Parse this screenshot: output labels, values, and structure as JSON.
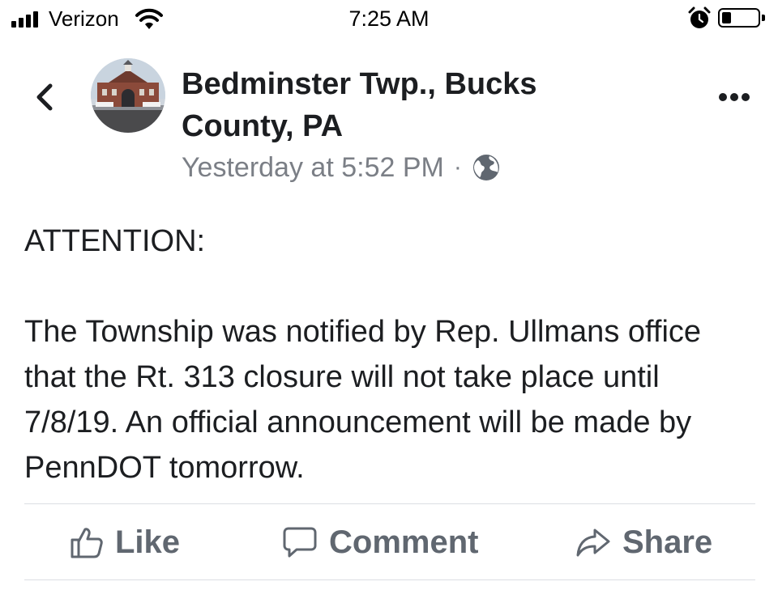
{
  "status_bar": {
    "carrier": "Verizon",
    "time": "7:25 AM",
    "battery_level": 0.25,
    "signal_bars": 4
  },
  "post": {
    "page_name": "Bedminster Twp., Bucks County, PA",
    "timestamp": "Yesterday at 5:52 PM",
    "separator": "·",
    "audience_icon": "globe-icon",
    "body_heading": "ATTENTION:",
    "body_text": "The Township was notified by Rep. Ullmans office that the Rt. 313 closure will not take place until 7/8/19. An official announcement will be made by PennDOT tomorrow."
  },
  "actions": {
    "like_label": "Like",
    "comment_label": "Comment",
    "share_label": "Share"
  },
  "colors": {
    "text": "#1c1e21",
    "meta": "#7b7f86",
    "action": "#606770",
    "divider": "#dcdee3"
  }
}
